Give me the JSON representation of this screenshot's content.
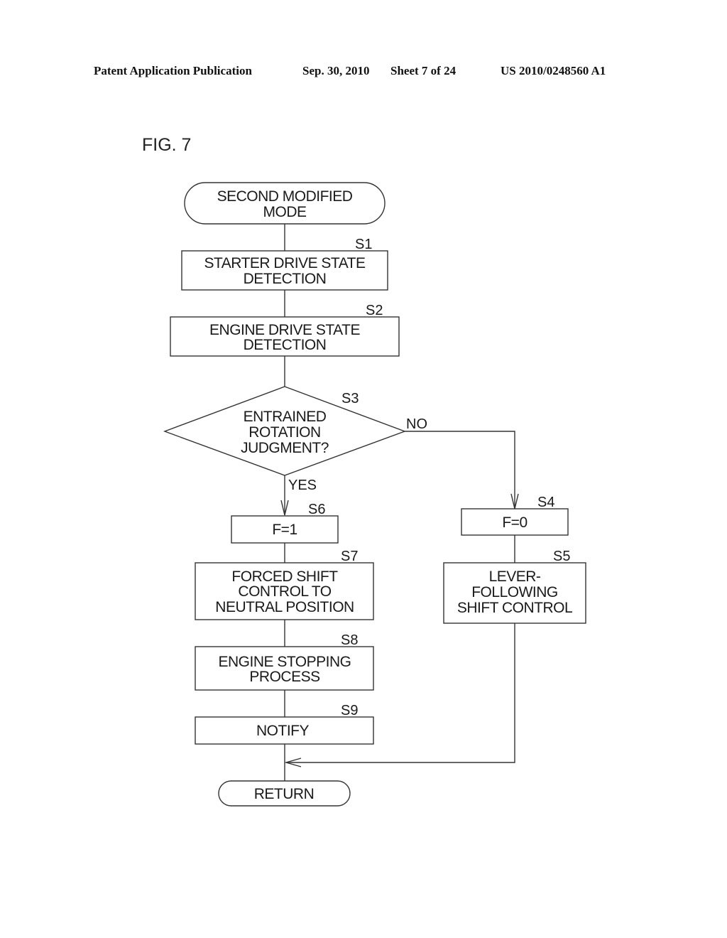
{
  "header": {
    "left": "Patent Application Publication",
    "date": "Sep. 30, 2010",
    "sheet": "Sheet 7 of 24",
    "number": "US 2010/0248560 A1"
  },
  "figure_label": "FIG. 7",
  "flowchart": {
    "start": {
      "lines": [
        "SECOND MODIFIED",
        "MODE"
      ]
    },
    "steps": {
      "s1": {
        "id": "S1",
        "lines": [
          "STARTER DRIVE STATE",
          "DETECTION"
        ]
      },
      "s2": {
        "id": "S2",
        "lines": [
          "ENGINE DRIVE STATE",
          "DETECTION"
        ]
      },
      "s3": {
        "id": "S3",
        "lines": [
          "ENTRAINED",
          "ROTATION",
          "JUDGMENT?"
        ],
        "yes": "YES",
        "no": "NO"
      },
      "s4": {
        "id": "S4",
        "lines": [
          "F=0"
        ]
      },
      "s5": {
        "id": "S5",
        "lines": [
          "LEVER-",
          "FOLLOWING",
          "SHIFT CONTROL"
        ]
      },
      "s6": {
        "id": "S6",
        "lines": [
          "F=1"
        ]
      },
      "s7": {
        "id": "S7",
        "lines": [
          "FORCED SHIFT",
          "CONTROL TO",
          "NEUTRAL POSITION"
        ]
      },
      "s8": {
        "id": "S8",
        "lines": [
          "ENGINE STOPPING",
          "PROCESS"
        ]
      },
      "s9": {
        "id": "S9",
        "lines": [
          "NOTIFY"
        ]
      }
    },
    "end": {
      "lines": [
        "RETURN"
      ]
    }
  }
}
